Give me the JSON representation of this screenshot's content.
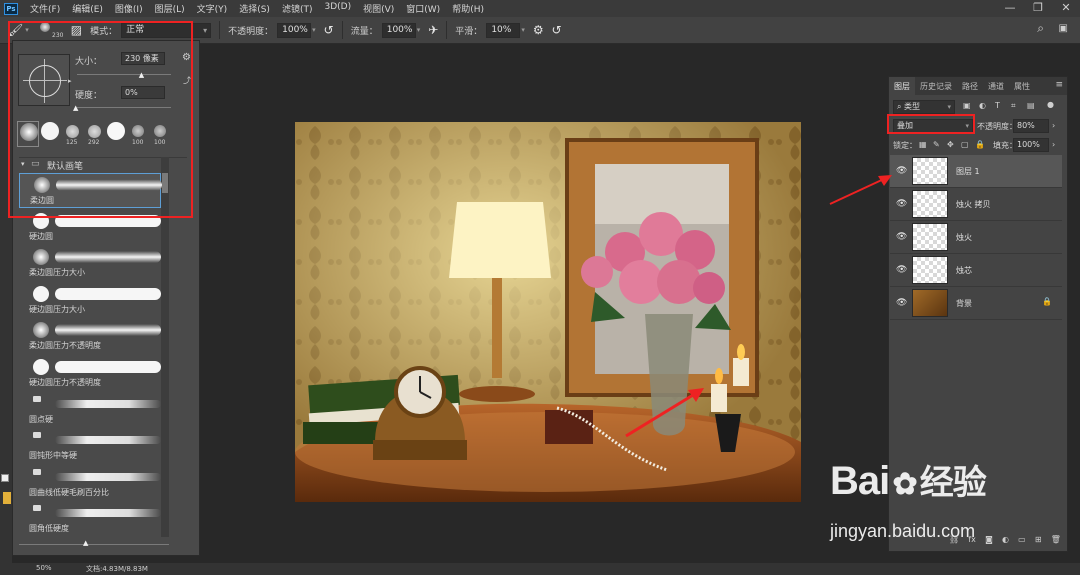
{
  "menu": [
    "文件(F)",
    "编辑(E)",
    "图像(I)",
    "图层(L)",
    "文字(Y)",
    "选择(S)",
    "滤镜(T)",
    "3D(D)",
    "视图(V)",
    "窗口(W)",
    "帮助(H)"
  ],
  "window_controls": {
    "minimize": "—",
    "restore": "❐",
    "close": "✕"
  },
  "options": {
    "brush_size_small": "230",
    "mode_label": "模式：",
    "mode_value": "正常",
    "opacity_label": "不透明度：",
    "opacity_value": "100%",
    "flow_label": "流量：",
    "flow_value": "100%",
    "smoothing_label": "平滑：",
    "smoothing_value": "10%"
  },
  "brush_panel": {
    "size_label": "大小：",
    "size_value": "230 像素",
    "size_fraction": 0.7,
    "hardness_label": "硬度：",
    "hardness_value": "0%",
    "recent": [
      {
        "label": ""
      },
      {
        "label": ""
      },
      {
        "label": "125"
      },
      {
        "label": "292"
      },
      {
        "label": ""
      },
      {
        "label": "100"
      },
      {
        "label": "100"
      }
    ],
    "group_name": "默认画笔",
    "brushes": [
      {
        "name": "柔边圆",
        "style": "soft"
      },
      {
        "name": "硬边圆",
        "style": "hard"
      },
      {
        "name": "柔边圆压力大小",
        "style": "soft"
      },
      {
        "name": "硬边圆压力大小",
        "style": "hard"
      },
      {
        "name": "柔边圆压力不透明度",
        "style": "soft"
      },
      {
        "name": "硬边圆压力不透明度",
        "style": "hard"
      },
      {
        "name": "圆点硬",
        "style": "tip"
      },
      {
        "name": "圆钝形中等硬",
        "style": "tip"
      },
      {
        "name": "圆曲线低硬毛刷百分比",
        "style": "tip"
      },
      {
        "name": "圆角低硬度",
        "style": "tip"
      }
    ]
  },
  "status": {
    "zoom": "50%",
    "doc": "文档:4.83M/8.83M"
  },
  "layers_panel": {
    "tabs": [
      "图层",
      "历史记录",
      "路径",
      "通道",
      "属性"
    ],
    "active_tab": 0,
    "filter_kind": "类型",
    "blend_mode": "叠加",
    "opacity_label": "不透明度：",
    "opacity_value": "80%",
    "lock_label": "锁定：",
    "fill_label": "填充：",
    "fill_value": "100%",
    "layers": [
      {
        "name": "图层 1",
        "type": "transparent",
        "active": true,
        "locked": false
      },
      {
        "name": "烛火 拷贝",
        "type": "transparent",
        "active": false,
        "locked": false
      },
      {
        "name": "烛火",
        "type": "transparent",
        "active": false,
        "locked": false
      },
      {
        "name": "烛芯",
        "type": "transparent",
        "active": false,
        "locked": false
      },
      {
        "name": "背景",
        "type": "photo",
        "active": false,
        "locked": true
      }
    ]
  },
  "watermark": {
    "brand": "Bai",
    "brand2": "经验",
    "url": "jingyan.baidu.com"
  },
  "colors": {
    "accent": "#e22222",
    "selection": "#5e9fd6"
  }
}
